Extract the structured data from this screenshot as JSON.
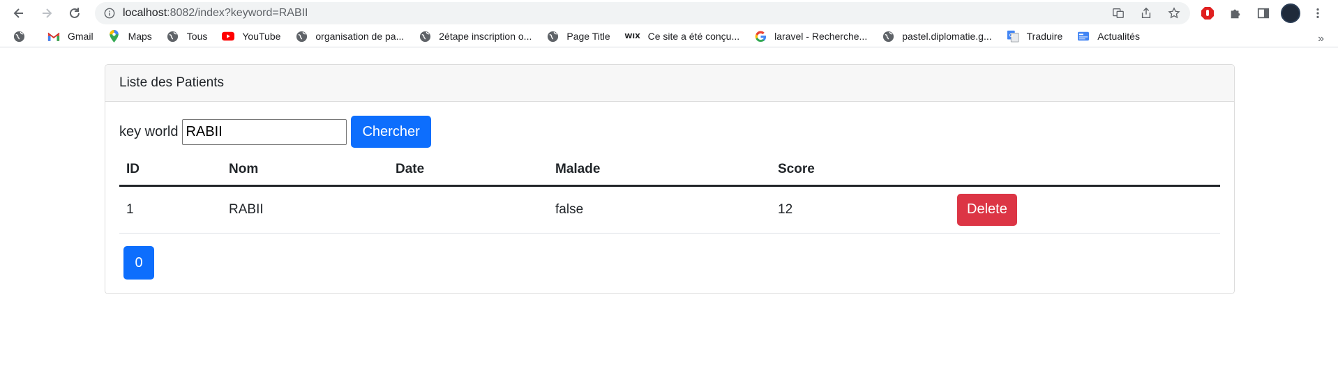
{
  "browser": {
    "url_host": "localhost",
    "url_path": ":8082/index?keyword=RABII",
    "bookmarks": [
      {
        "label": "",
        "icon": "globe-icon"
      },
      {
        "label": "Gmail",
        "icon": "gmail-icon"
      },
      {
        "label": "Maps",
        "icon": "maps-icon"
      },
      {
        "label": "Tous",
        "icon": "globe-icon"
      },
      {
        "label": "YouTube",
        "icon": "youtube-icon"
      },
      {
        "label": "organisation de pa...",
        "icon": "globe-icon"
      },
      {
        "label": "2étape inscription o...",
        "icon": "globe-icon"
      },
      {
        "label": "Page Title",
        "icon": "globe-icon"
      },
      {
        "label": "Ce site a été conçu...",
        "icon": "wix-icon"
      },
      {
        "label": "laravel - Recherche...",
        "icon": "google-icon"
      },
      {
        "label": "pastel.diplomatie.g...",
        "icon": "globe-icon"
      },
      {
        "label": "Traduire",
        "icon": "translate-icon"
      },
      {
        "label": "Actualités",
        "icon": "news-icon"
      }
    ],
    "more": "»"
  },
  "card": {
    "title": "Liste des Patients",
    "search_label": "key world",
    "search_value": "RABII",
    "search_button": "Chercher"
  },
  "table": {
    "headers": [
      "ID",
      "Nom",
      "Date",
      "Malade",
      "Score",
      ""
    ],
    "rows": [
      {
        "id": "1",
        "nom": "RABII",
        "date": "",
        "malade": "false",
        "score": "12",
        "action": "Delete"
      }
    ]
  },
  "pagination": {
    "pages": [
      "0"
    ]
  },
  "colors": {
    "primary": "#0d6efd",
    "danger": "#dc3545"
  }
}
